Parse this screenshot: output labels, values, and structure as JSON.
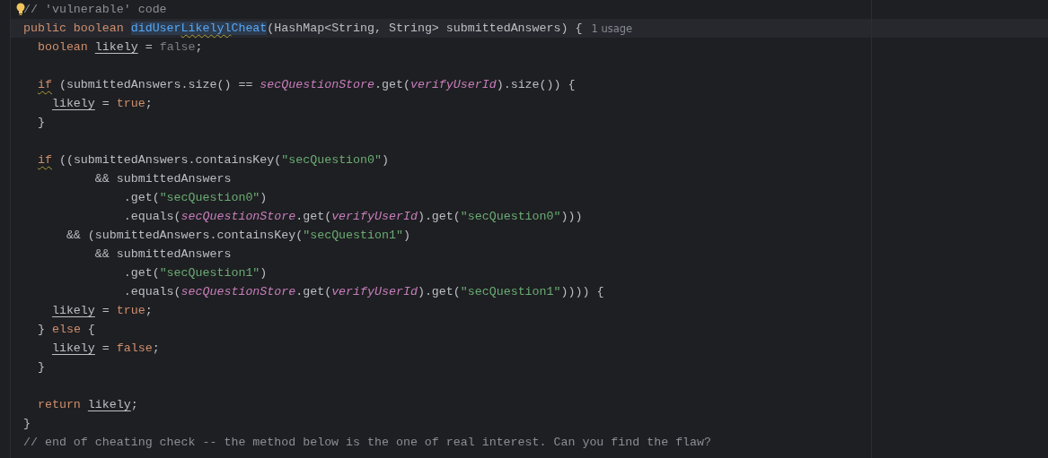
{
  "editor": {
    "lines": [
      {
        "intention_bulb": true,
        "tokens": [
          {
            "kind": "comment",
            "text": "// 'vulnerable' code"
          }
        ]
      },
      {
        "current": true,
        "usage_hint": "1 usage",
        "tokens": [
          {
            "kind": "keyword",
            "text": "public boolean "
          },
          {
            "kind": "decl",
            "text": "didUser"
          },
          {
            "kind": "decl-typo",
            "text": "Likelyl"
          },
          {
            "kind": "decl",
            "text": "Cheat"
          },
          {
            "kind": "plain",
            "text": "(HashMap<String, String> submittedAnswers) {"
          }
        ]
      },
      {
        "tokens": [
          {
            "kind": "keyword",
            "text": "  boolean "
          },
          {
            "kind": "var",
            "text": "likely"
          },
          {
            "kind": "plain",
            "text": " = "
          },
          {
            "kind": "unused",
            "text": "false"
          },
          {
            "kind": "plain",
            "text": ";"
          }
        ]
      },
      {
        "space_before": true,
        "tokens": [
          {
            "kind": "keyword-warn",
            "text": "  if"
          },
          {
            "kind": "plain",
            "text": " (submittedAnswers.size() == "
          },
          {
            "kind": "field",
            "text": "secQuestionStore"
          },
          {
            "kind": "plain",
            "text": ".get("
          },
          {
            "kind": "field",
            "text": "verifyUserId"
          },
          {
            "kind": "plain",
            "text": ").size()) {"
          }
        ]
      },
      {
        "tokens": [
          {
            "kind": "var",
            "text": "    likely"
          },
          {
            "kind": "plain",
            "text": " = "
          },
          {
            "kind": "keyword",
            "text": "true"
          },
          {
            "kind": "plain",
            "text": ";"
          }
        ]
      },
      {
        "tokens": [
          {
            "kind": "plain",
            "text": "  }"
          }
        ]
      },
      {
        "space_before": true,
        "tokens": [
          {
            "kind": "keyword-warn",
            "text": "  if"
          },
          {
            "kind": "plain",
            "text": " ((submittedAnswers.containsKey("
          },
          {
            "kind": "string",
            "text": "\"secQuestion0\""
          },
          {
            "kind": "plain",
            "text": ")"
          }
        ]
      },
      {
        "tokens": [
          {
            "kind": "plain",
            "text": "          && submittedAnswers"
          }
        ]
      },
      {
        "tokens": [
          {
            "kind": "plain",
            "text": "              .get("
          },
          {
            "kind": "string",
            "text": "\"secQuestion0\""
          },
          {
            "kind": "plain",
            "text": ")"
          }
        ]
      },
      {
        "tokens": [
          {
            "kind": "plain",
            "text": "              .equals("
          },
          {
            "kind": "field",
            "text": "secQuestionStore"
          },
          {
            "kind": "plain",
            "text": ".get("
          },
          {
            "kind": "field",
            "text": "verifyUserId"
          },
          {
            "kind": "plain",
            "text": ").get("
          },
          {
            "kind": "string",
            "text": "\"secQuestion0\""
          },
          {
            "kind": "plain",
            "text": ")))"
          }
        ]
      },
      {
        "tokens": [
          {
            "kind": "plain",
            "text": "      && (submittedAnswers.containsKey("
          },
          {
            "kind": "string",
            "text": "\"secQuestion1\""
          },
          {
            "kind": "plain",
            "text": ")"
          }
        ]
      },
      {
        "tokens": [
          {
            "kind": "plain",
            "text": "          && submittedAnswers"
          }
        ]
      },
      {
        "tokens": [
          {
            "kind": "plain",
            "text": "              .get("
          },
          {
            "kind": "string",
            "text": "\"secQuestion1\""
          },
          {
            "kind": "plain",
            "text": ")"
          }
        ]
      },
      {
        "tokens": [
          {
            "kind": "plain",
            "text": "              .equals("
          },
          {
            "kind": "field",
            "text": "secQuestionStore"
          },
          {
            "kind": "plain",
            "text": ".get("
          },
          {
            "kind": "field",
            "text": "verifyUserId"
          },
          {
            "kind": "plain",
            "text": ").get("
          },
          {
            "kind": "string",
            "text": "\"secQuestion1\""
          },
          {
            "kind": "plain",
            "text": ")))) {"
          }
        ]
      },
      {
        "tokens": [
          {
            "kind": "var",
            "text": "    likely"
          },
          {
            "kind": "plain",
            "text": " = "
          },
          {
            "kind": "keyword",
            "text": "true"
          },
          {
            "kind": "plain",
            "text": ";"
          }
        ]
      },
      {
        "tokens": [
          {
            "kind": "plain",
            "text": "  } "
          },
          {
            "kind": "keyword",
            "text": "else"
          },
          {
            "kind": "plain",
            "text": " {"
          }
        ]
      },
      {
        "tokens": [
          {
            "kind": "var",
            "text": "    likely"
          },
          {
            "kind": "plain",
            "text": " = "
          },
          {
            "kind": "keyword",
            "text": "false"
          },
          {
            "kind": "plain",
            "text": ";"
          }
        ]
      },
      {
        "tokens": [
          {
            "kind": "plain",
            "text": "  }"
          }
        ]
      },
      {
        "space_before": true,
        "tokens": [
          {
            "kind": "keyword",
            "text": "  return "
          },
          {
            "kind": "var",
            "text": "likely"
          },
          {
            "kind": "plain",
            "text": ";"
          }
        ]
      },
      {
        "tokens": [
          {
            "kind": "plain",
            "text": "}"
          }
        ]
      },
      {
        "tokens": [
          {
            "kind": "comment",
            "text": "// end of cheating check -- the method below is the one of real interest. Can you find the flaw?"
          }
        ]
      }
    ]
  }
}
